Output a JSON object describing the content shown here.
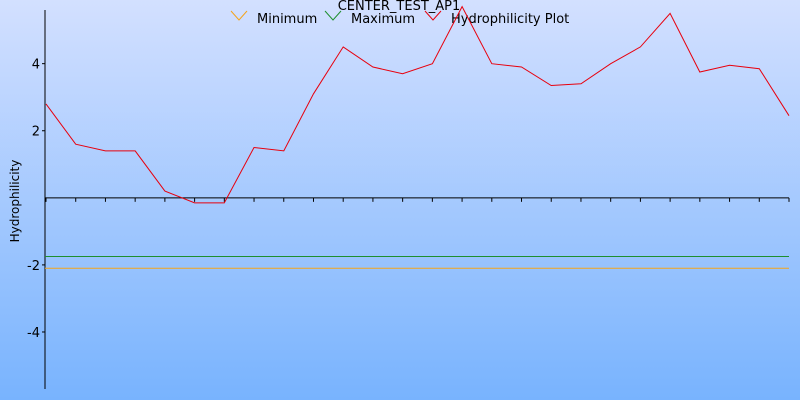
{
  "chart_data": {
    "type": "line",
    "title": "CENTER_TEST_AP1",
    "xlabel": "",
    "ylabel": "Hydrophilicity",
    "ylim": [
      -5.7,
      5.6
    ],
    "yticks": [
      -4,
      -2,
      2,
      4
    ],
    "x_count": 26,
    "legend_position": "top",
    "series": [
      {
        "name": "Minimum",
        "color": "#f4a41c",
        "values": [
          -2.1,
          -2.1
        ]
      },
      {
        "name": "Maximum",
        "color": "#1e8f2e",
        "values": [
          -1.75,
          -1.75
        ]
      },
      {
        "name": "Hydrophilicity Plot",
        "color": "#e8000d",
        "values": [
          2.8,
          1.6,
          1.4,
          1.4,
          0.2,
          -0.15,
          -0.15,
          1.5,
          1.4,
          3.1,
          4.5,
          3.9,
          3.7,
          4.0,
          5.7,
          4.0,
          3.9,
          3.35,
          3.4,
          4.0,
          4.5,
          5.5,
          3.75,
          3.95,
          3.85,
          2.45
        ]
      }
    ]
  }
}
